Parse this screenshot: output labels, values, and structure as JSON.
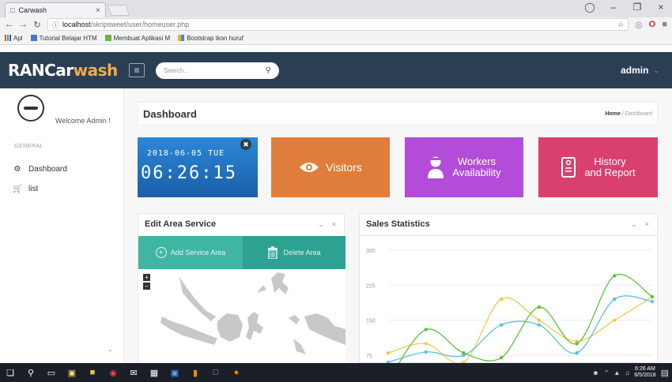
{
  "browser": {
    "tab_title": "Carwash",
    "url_host": "localhost",
    "url_path": "/skripsweet/user/homeuser.php",
    "bookmarks": [
      {
        "label": "Apl"
      },
      {
        "label": "Tutorial Belajar HTM"
      },
      {
        "label": "Membuat Aplikasi M"
      },
      {
        "label": "Bootstrap ikon huruf"
      }
    ]
  },
  "header": {
    "logo_main": "RANCar",
    "logo_accent": "wash",
    "search_placeholder": "Search...",
    "user": "admin"
  },
  "sidebar": {
    "welcome": "Welcome Admin !",
    "section": "GENERAL",
    "items": [
      {
        "label": "Dashboard"
      },
      {
        "label": "list"
      }
    ]
  },
  "page": {
    "title": "Dashboard",
    "breadcrumb_home": "Home",
    "breadcrumb_sep": "/",
    "breadcrumb_current": "Dashboard"
  },
  "tiles": {
    "clock_date": "2018-06-05 TUE",
    "clock_time": "06:26:15",
    "visitors": "Visitors",
    "workers_line1": "Workers",
    "workers_line2": "Availability",
    "history_line1": "History",
    "history_line2": "and Report"
  },
  "service_panel": {
    "title": "Edit Area Service",
    "add_label": "Add Service Area",
    "delete_label": "Delete Area"
  },
  "chart_data": {
    "type": "line",
    "title": "Sales Statistics",
    "ylim": [
      50,
      320
    ],
    "yticks": [
      75,
      150,
      225,
      300
    ],
    "x": [
      0,
      1,
      2,
      3,
      4,
      5,
      6,
      7
    ],
    "series": [
      {
        "color": "#f4c94a",
        "values": [
          80,
          100,
          60,
          195,
          150,
          105,
          150,
          200
        ]
      },
      {
        "color": "#5bc0de",
        "values": [
          60,
          82,
          75,
          140,
          140,
          80,
          195,
          190
        ]
      },
      {
        "color": "#5cc040",
        "values": [
          20,
          130,
          80,
          70,
          178,
          100,
          245,
          200
        ]
      }
    ],
    "grid": true
  },
  "taskbar": {
    "time": "6:26 AM",
    "date": "6/5/2018"
  },
  "colors": {
    "header_bg": "#2a3f54",
    "logo_accent": "#f0ad4e",
    "tile_clock": "#1e6bb8",
    "tile_visitors": "#e07d3b",
    "tile_workers": "#b24cd9",
    "tile_history": "#d8416e",
    "service_teal": "#3fb6a4"
  }
}
